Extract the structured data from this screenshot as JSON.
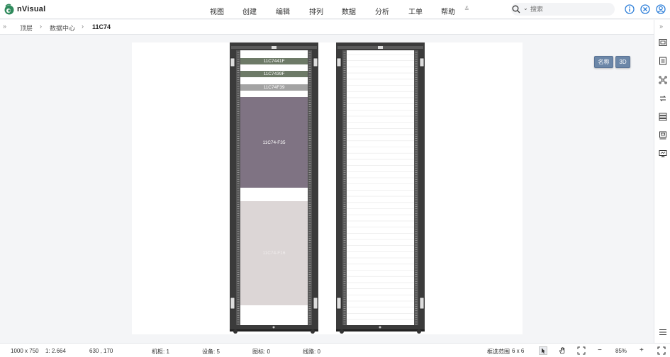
{
  "app": {
    "name": "nVisual"
  },
  "menu": [
    "视图",
    "创建",
    "编辑",
    "排列",
    "数据",
    "分析",
    "工单",
    "帮助"
  ],
  "menu_more": "≚",
  "search": {
    "placeholder": "搜索"
  },
  "breadcrumb": {
    "toggle": "»",
    "items": [
      "顶层",
      "数据中心",
      "11C74"
    ],
    "sep": "›"
  },
  "sidebar_toggle": "»",
  "overlay_buttons": {
    "name": "名称",
    "three_d": "3D"
  },
  "rack1_devices": [
    {
      "label": "11C7441F",
      "color": "#6d7a67"
    },
    {
      "label": "11C7439F",
      "color": "#6d7a67"
    },
    {
      "label": "11C74F39",
      "color": "#a3a3a3"
    },
    {
      "label": "11C74-F35",
      "color": "#7f7383"
    },
    {
      "label": "11C74-F16",
      "color": "#dcd6d6"
    }
  ],
  "status": {
    "resolution": "1000 x 750",
    "scale": "1: 2.664",
    "coords": "630 , 170",
    "cabinets": "机柜: 1",
    "devices": "设备: 5",
    "icons": "图标: 0",
    "lines": "线路: 0",
    "select_range": "框选范围",
    "select_value": "6 x 6",
    "zoom": "85%",
    "zoom_out": "−",
    "zoom_in": "+"
  },
  "colors": {
    "accent": "#2e7fd9",
    "rack_frame": "#3b3b3b",
    "brand_green": "#3d8f5e"
  }
}
